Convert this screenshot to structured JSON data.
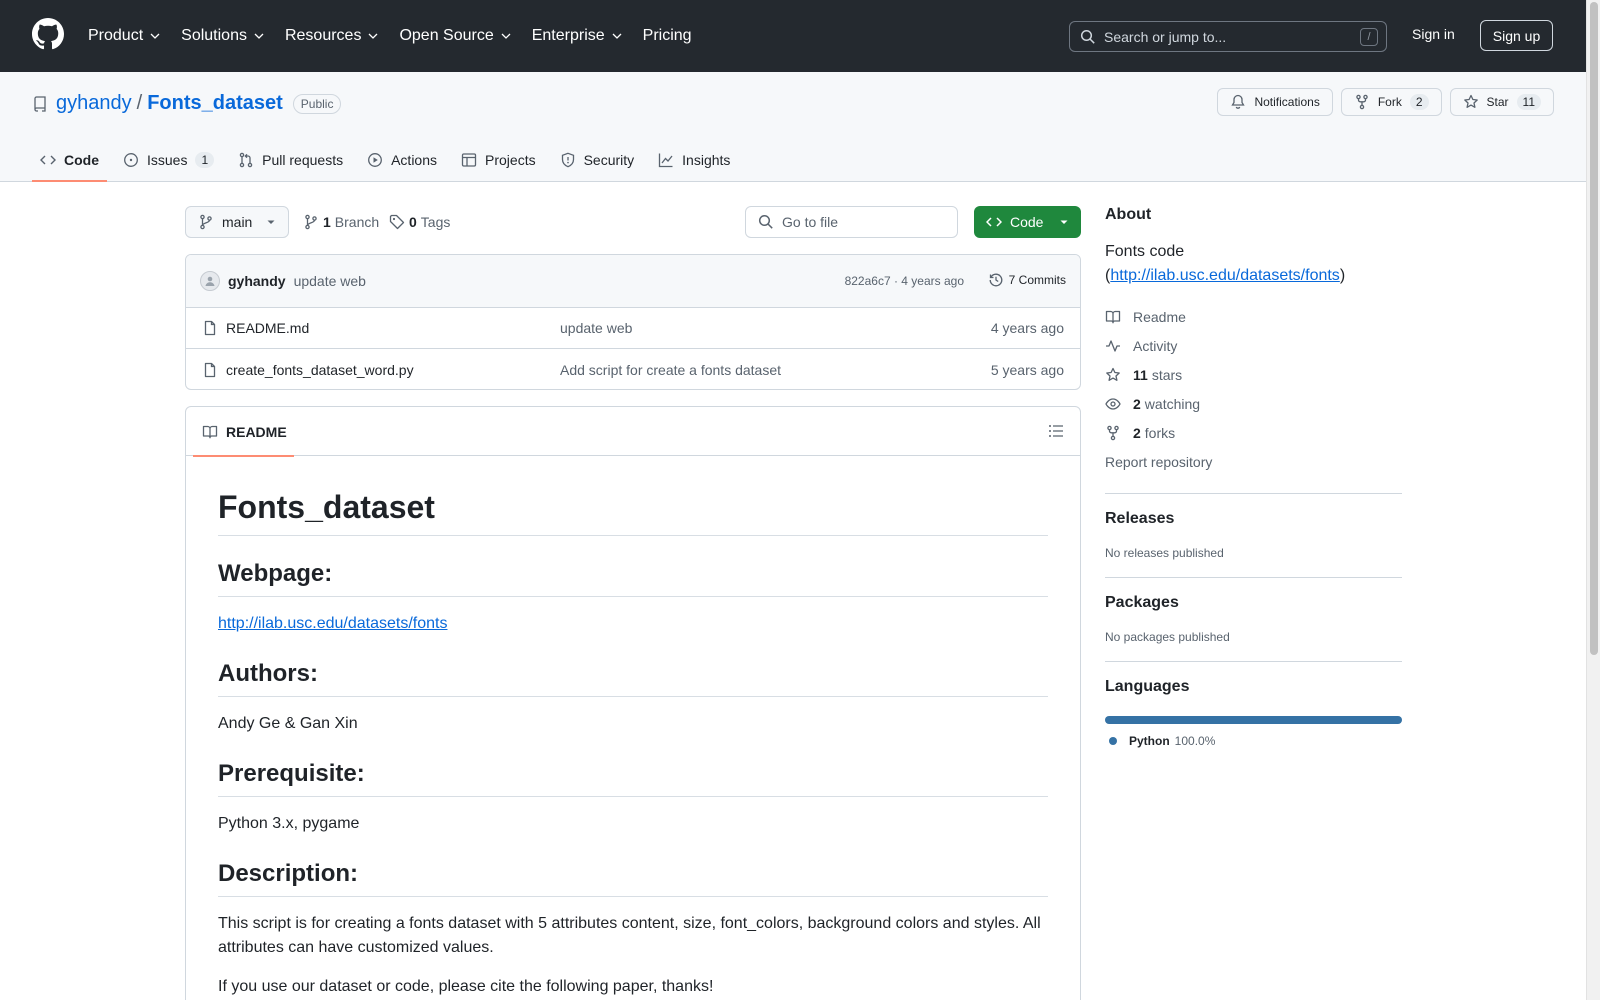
{
  "header": {
    "nav": [
      {
        "label": "Product",
        "dropdown": true
      },
      {
        "label": "Solutions",
        "dropdown": true
      },
      {
        "label": "Resources",
        "dropdown": true
      },
      {
        "label": "Open Source",
        "dropdown": true
      },
      {
        "label": "Enterprise",
        "dropdown": true
      },
      {
        "label": "Pricing",
        "dropdown": false
      }
    ],
    "search_placeholder": "Search or jump to...",
    "search_shortcut": "/",
    "sign_in": "Sign in",
    "sign_up": "Sign up"
  },
  "repo": {
    "owner": "gyhandy",
    "separator": "/",
    "name": "Fonts_dataset",
    "visibility": "Public",
    "notifications_label": "Notifications",
    "fork_label": "Fork",
    "fork_count": "2",
    "star_label": "Star",
    "star_count": "11",
    "tabs": [
      {
        "label": "Code",
        "count": ""
      },
      {
        "label": "Issues",
        "count": "1"
      },
      {
        "label": "Pull requests",
        "count": ""
      },
      {
        "label": "Actions",
        "count": ""
      },
      {
        "label": "Projects",
        "count": ""
      },
      {
        "label": "Security",
        "count": ""
      },
      {
        "label": "Insights",
        "count": ""
      }
    ]
  },
  "toolbar": {
    "branch": "main",
    "branches_count": "1",
    "branches_label": "Branch",
    "tags_count": "0",
    "tags_label": "Tags",
    "goto_placeholder": "Go to file",
    "code_label": "Code"
  },
  "latest_commit": {
    "author": "gyhandy",
    "message": "update web",
    "meta": "822a6c7 · 4 years ago",
    "commits_label": "7 Commits"
  },
  "files": [
    {
      "name": "README.md",
      "message": "update web",
      "date": "4 years ago"
    },
    {
      "name": "create_fonts_dataset_word.py",
      "message": "Add script for create a fonts dataset",
      "date": "5 years ago"
    }
  ],
  "readme": {
    "tab_label": "README",
    "title": "Fonts_dataset",
    "webpage_heading": "Webpage:",
    "webpage_url": "http://ilab.usc.edu/datasets/fonts",
    "authors_heading": "Authors:",
    "authors": "Andy Ge & Gan Xin",
    "prereq_heading": "Prerequisite:",
    "prereq": "Python 3.x, pygame",
    "description_heading": "Description:",
    "description": "This script is for creating a fonts dataset with 5 attributes content, size, font_colors, background colors and styles. All attributes can have customized values.",
    "cite": "If you use our dataset or code, please cite the following paper, thanks!"
  },
  "sidebar": {
    "about_heading": "About",
    "about_text": "Fonts code",
    "about_open": "(",
    "about_link": "http://ilab.usc.edu/datasets/fonts",
    "about_close": ")",
    "readme": "Readme",
    "activity": "Activity",
    "stars_count": "11",
    "stars_label": "stars",
    "watching_count": "2",
    "watching_label": "watching",
    "forks_count": "2",
    "forks_label": "forks",
    "report": "Report repository",
    "releases_heading": "Releases",
    "releases_text": "No releases published",
    "packages_heading": "Packages",
    "packages_text": "No packages published",
    "languages_heading": "Languages",
    "languages": [
      {
        "name": "Python",
        "percent": "100.0%",
        "fraction": 1.0,
        "color": "#3572A5"
      }
    ]
  },
  "colors": {
    "header_bg": "#24292f",
    "link": "#0969da",
    "primary_button": "#1f883d",
    "active_tab_underline": "#fd8c73"
  }
}
